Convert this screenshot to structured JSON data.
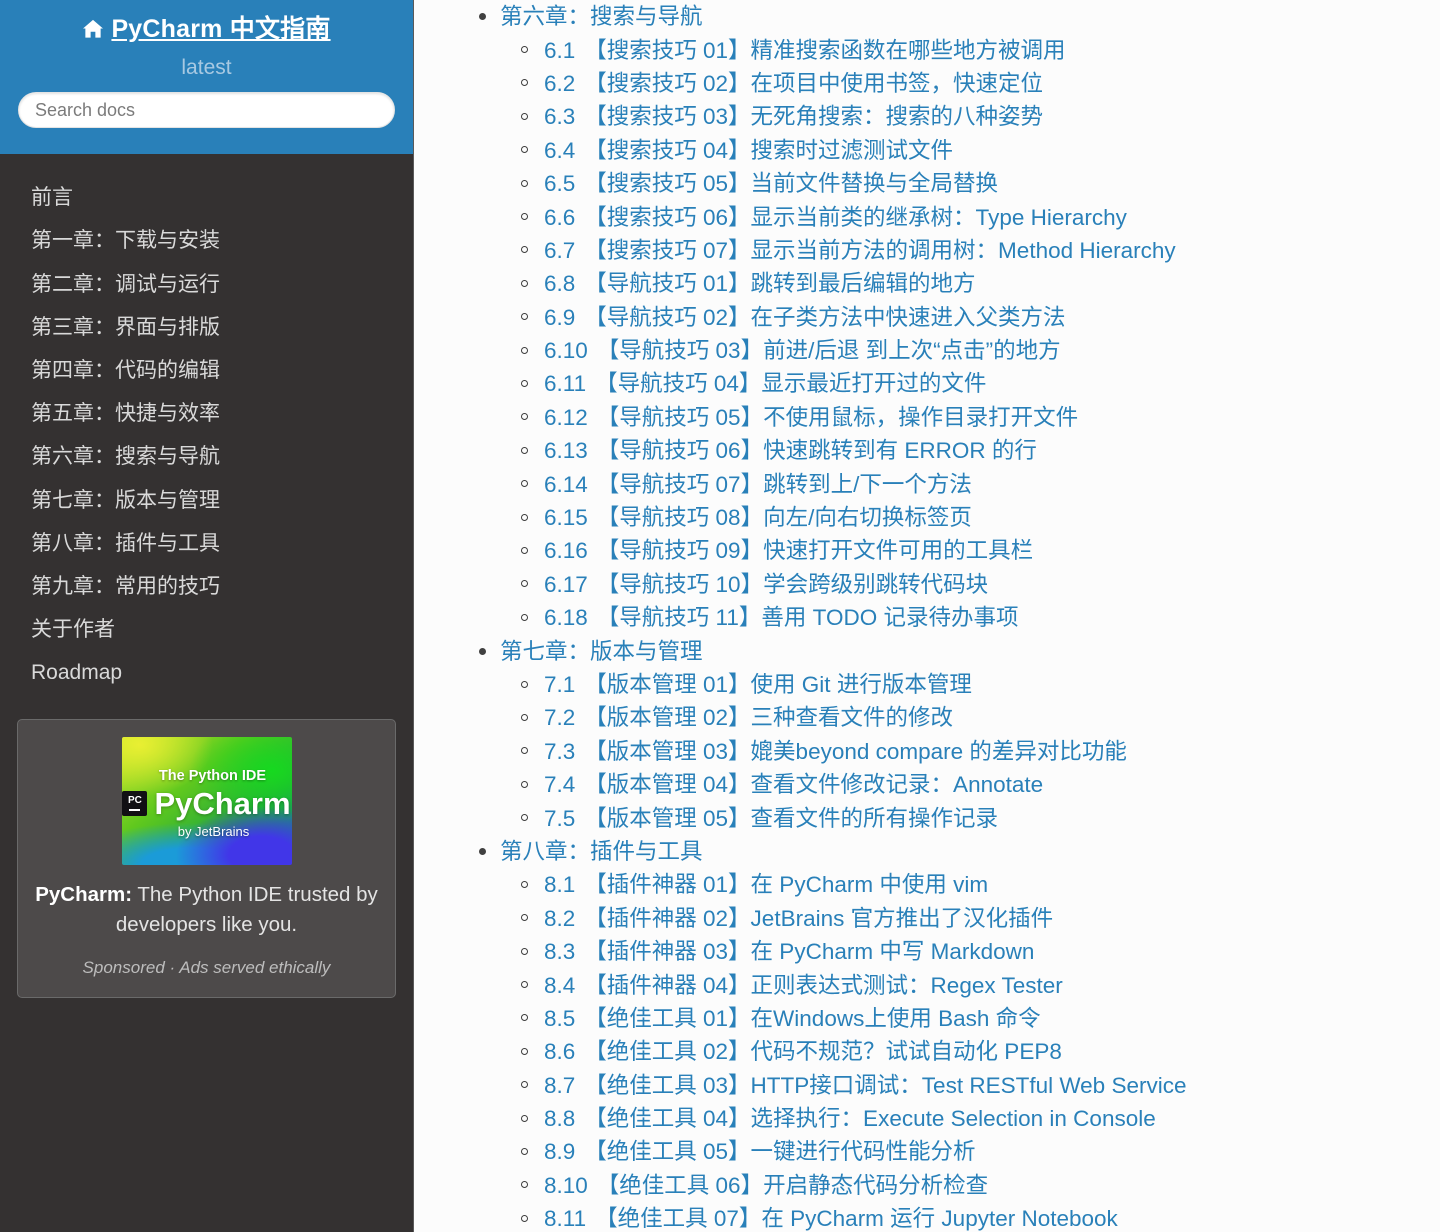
{
  "sidebar": {
    "brand": "PyCharm 中文指南",
    "home_icon": "home-icon",
    "version": "latest",
    "search": {
      "placeholder": "Search docs",
      "value": ""
    },
    "nav_items": [
      {
        "label": "前言"
      },
      {
        "label": "第一章：下载与安装"
      },
      {
        "label": "第二章：调试与运行"
      },
      {
        "label": "第三章：界面与排版"
      },
      {
        "label": "第四章：代码的编辑"
      },
      {
        "label": "第五章：快捷与效率"
      },
      {
        "label": "第六章：搜索与导航"
      },
      {
        "label": "第七章：版本与管理"
      },
      {
        "label": "第八章：插件与工具"
      },
      {
        "label": "第九章：常用的技巧"
      },
      {
        "label": "关于作者"
      },
      {
        "label": "Roadmap"
      }
    ],
    "ad": {
      "image_tagline": "The Python IDE",
      "image_badge": "PC",
      "image_product": "PyCharm",
      "image_by": "by JetBrains",
      "text_strong": "PyCharm:",
      "text_rest": " The Python IDE trusted by developers like you.",
      "note": "Sponsored · Ads served ethically"
    }
  },
  "main": {
    "chapters": [
      {
        "title": "第六章：搜索与导航",
        "sections": [
          {
            "num": "6.1",
            "title": "【搜索技巧 01】精准搜索函数在哪些地方被调用"
          },
          {
            "num": "6.2",
            "title": "【搜索技巧 02】在项目中使用书签，快速定位"
          },
          {
            "num": "6.3",
            "title": "【搜索技巧 03】无死角搜索：搜索的八种姿势"
          },
          {
            "num": "6.4",
            "title": "【搜索技巧 04】搜索时过滤测试文件"
          },
          {
            "num": "6.5",
            "title": "【搜索技巧 05】当前文件替换与全局替换"
          },
          {
            "num": "6.6",
            "title": "【搜索技巧 06】显示当前类的继承树：Type Hierarchy"
          },
          {
            "num": "6.7",
            "title": "【搜索技巧 07】显示当前方法的调用树：Method Hierarchy"
          },
          {
            "num": "6.8",
            "title": "【导航技巧 01】跳转到最后编辑的地方"
          },
          {
            "num": "6.9",
            "title": "【导航技巧 02】在子类方法中快速进入父类方法"
          },
          {
            "num": "6.10",
            "title": "【导航技巧 03】前进/后退 到上次“点击”的地方"
          },
          {
            "num": "6.11",
            "title": "【导航技巧 04】显示最近打开过的文件"
          },
          {
            "num": "6.12",
            "title": "【导航技巧 05】不使用鼠标，操作目录打开文件"
          },
          {
            "num": "6.13",
            "title": "【导航技巧 06】快速跳转到有 ERROR 的行"
          },
          {
            "num": "6.14",
            "title": "【导航技巧 07】跳转到上/下一个方法"
          },
          {
            "num": "6.15",
            "title": "【导航技巧 08】向左/向右切换标签页"
          },
          {
            "num": "6.16",
            "title": "【导航技巧 09】快速打开文件可用的工具栏"
          },
          {
            "num": "6.17",
            "title": "【导航技巧 10】学会跨级别跳转代码块"
          },
          {
            "num": "6.18",
            "title": "【导航技巧 11】善用 TODO 记录待办事项"
          }
        ]
      },
      {
        "title": "第七章：版本与管理",
        "sections": [
          {
            "num": "7.1",
            "title": "【版本管理 01】使用 Git 进行版本管理"
          },
          {
            "num": "7.2",
            "title": "【版本管理 02】三种查看文件的修改"
          },
          {
            "num": "7.3",
            "title": "【版本管理 03】媲美beyond compare 的差异对比功能"
          },
          {
            "num": "7.4",
            "title": "【版本管理 04】查看文件修改记录：Annotate"
          },
          {
            "num": "7.5",
            "title": "【版本管理 05】查看文件的所有操作记录"
          }
        ]
      },
      {
        "title": "第八章：插件与工具",
        "sections": [
          {
            "num": "8.1",
            "title": "【插件神器 01】在 PyCharm 中使用 vim"
          },
          {
            "num": "8.2",
            "title": "【插件神器 02】JetBrains 官方推出了汉化插件"
          },
          {
            "num": "8.3",
            "title": "【插件神器 03】在 PyCharm 中写 Markdown"
          },
          {
            "num": "8.4",
            "title": "【插件神器 04】正则表达式测试：Regex Tester"
          },
          {
            "num": "8.5",
            "title": "【绝佳工具 01】在Windows上使用 Bash 命令"
          },
          {
            "num": "8.6",
            "title": "【绝佳工具 02】代码不规范？试试自动化 PEP8"
          },
          {
            "num": "8.7",
            "title": "【绝佳工具 03】HTTP接口调试：Test RESTful Web Service"
          },
          {
            "num": "8.8",
            "title": "【绝佳工具 04】选择执行：Execute Selection in Console"
          },
          {
            "num": "8.9",
            "title": "【绝佳工具 05】一键进行代码性能分析"
          },
          {
            "num": "8.10",
            "title": "【绝佳工具 06】开启静态代码分析检查"
          },
          {
            "num": "8.11",
            "title": "【绝佳工具 07】在 PyCharm 运行 Jupyter Notebook"
          }
        ]
      }
    ]
  },
  "colors": {
    "header_blue": "#2980b9",
    "sidebar_dark": "#343131",
    "link_blue": "#2980b9",
    "content_bg": "#fcfcfc",
    "ad_card_bg": "#4d4a4a"
  }
}
